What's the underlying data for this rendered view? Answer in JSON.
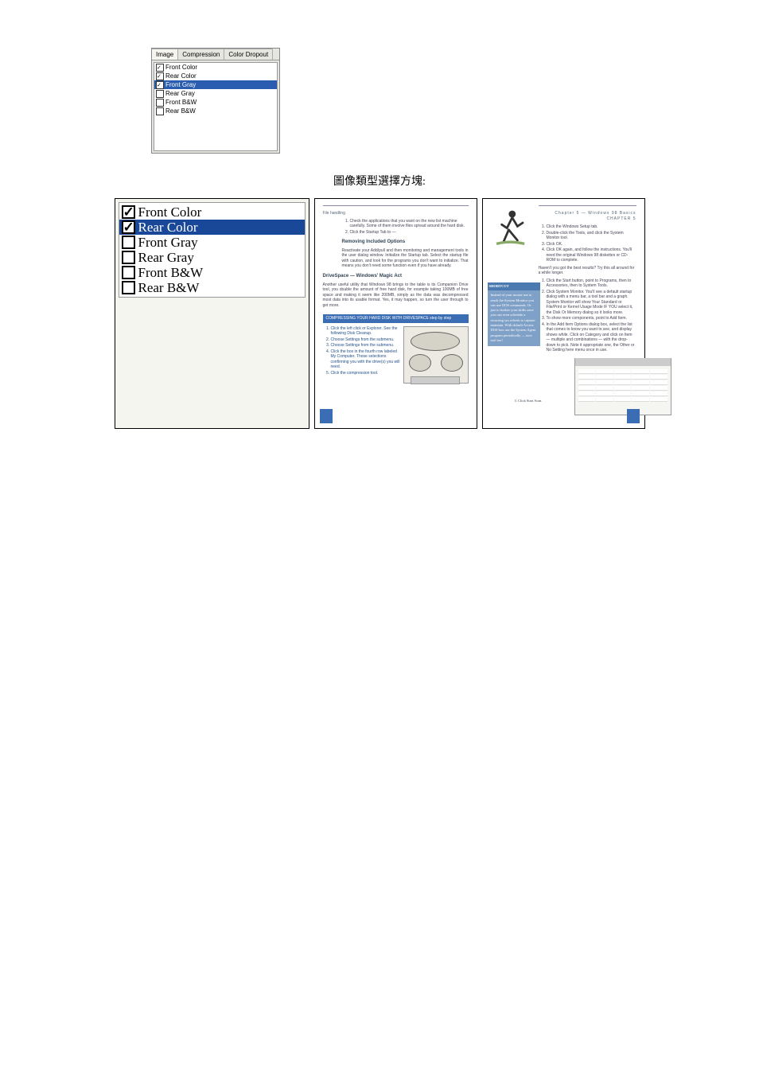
{
  "upper": {
    "tabs": [
      "Image",
      "Compression",
      "Color Dropout"
    ],
    "items": [
      {
        "label": "Front Color",
        "checked": true,
        "sel": false
      },
      {
        "label": "Rear Color",
        "checked": true,
        "sel": false
      },
      {
        "label": "Front Gray",
        "checked": true,
        "sel": true
      },
      {
        "label": "Rear Gray",
        "checked": false,
        "sel": false
      },
      {
        "label": "Front B&W",
        "checked": false,
        "sel": false
      },
      {
        "label": "Rear B&W",
        "checked": false,
        "sel": false
      }
    ]
  },
  "caption": "圖像類型選擇方塊:",
  "panel1": {
    "items": [
      {
        "label": "Front Color",
        "checked": true,
        "sel": false
      },
      {
        "label": "Rear Color",
        "checked": true,
        "sel": true
      },
      {
        "label": "Front Gray",
        "checked": false,
        "sel": false
      },
      {
        "label": "Rear Gray",
        "checked": false,
        "sel": false
      },
      {
        "label": "Front B&W",
        "checked": false,
        "sel": false
      },
      {
        "label": "Rear B&W",
        "checked": false,
        "sel": false
      }
    ]
  },
  "panel2": {
    "breadcrumb": "File handling",
    "heading1": "Removing Included Options",
    "heading2": "DriveSpace — Windows' Magic Act",
    "bluebar": "COMPRESSING YOUR HARD DISK WITH DRIVESPACE step by step",
    "page": "",
    "body1": "Check the applications that you want on the new list machine carefully. Some of them involve files spread around the hard disk.",
    "body2": "Click the Startup Tab to —",
    "body3": "Reactivate your Add/pull and then monitoring and management tools in the user dialog window. Initialize the Startup tab. Select the startup file with caution, and look for the programs you don't want to initialize. That means you don't need some function even if you have already.",
    "body4": "Another useful utility that Windows 98 brings to the table is its Companion Drive tool, you double the amount of free hard disk, for example taking 100MB of free space and making it seem like 200MB, simply as the data was decompressed most data into its usable format. Yes, it may happen, so turn the user through to get more.",
    "steps": [
      "Click the left click or Explorer. See the following Disk Cleanup.",
      "Choose Settings from the submenu.",
      "Choose Settings from the submenu.",
      "Click the box in the fourth row labeled My Computer. Those selections confirming you with the drive(s) you will need.",
      "Click the compression tool."
    ]
  },
  "panel3": {
    "chapter": "Chapter 5 — Windows 98 Basics CHAPTER 5",
    "steps_top": [
      "Click the Windows Setup tab.",
      "Double-click the Tools, and click the System Monitor tool.",
      "Click OK.",
      "Click OK again, and follow the instructions. You'll need the original Windows 98 diskettes or CD-ROM to complete."
    ],
    "hint": "Haven't you got the best results? Try this all around for a while longer.",
    "steps_mid": [
      "Click the Start button, point to Programs, then to Accessories, then to System Tools.",
      "Click System Monitor. You'll see a default startup dialog with a menu bar, a tool bar and a graph. System Monitor will show Your Standard or File/Print or Kernel Usage Mode IF YOU select it, the Disk Or Memory dialog so it looks more.",
      "To show more components, point to Add Item.",
      "In the Add Item Options dialog box, select the list that comes to know you want to see, and display shows while. Click on Category and click on Item — multiple and combinations — with the drop-down to pick. Note it appropriate one, the Other or No Setting here menu once in use."
    ],
    "shortcut_header": "SHORTCUT",
    "shortcut_body": "Instead of your mouse use to reach the System Monitor you can use DOS commands. Or just to further your skills once you can even schedule a recurring sys refresh to capture maintain. With default Access DOS box use the System Agent program periodically — nice tool too!",
    "bottom": "3. Click Start Scan.",
    "page": ""
  }
}
